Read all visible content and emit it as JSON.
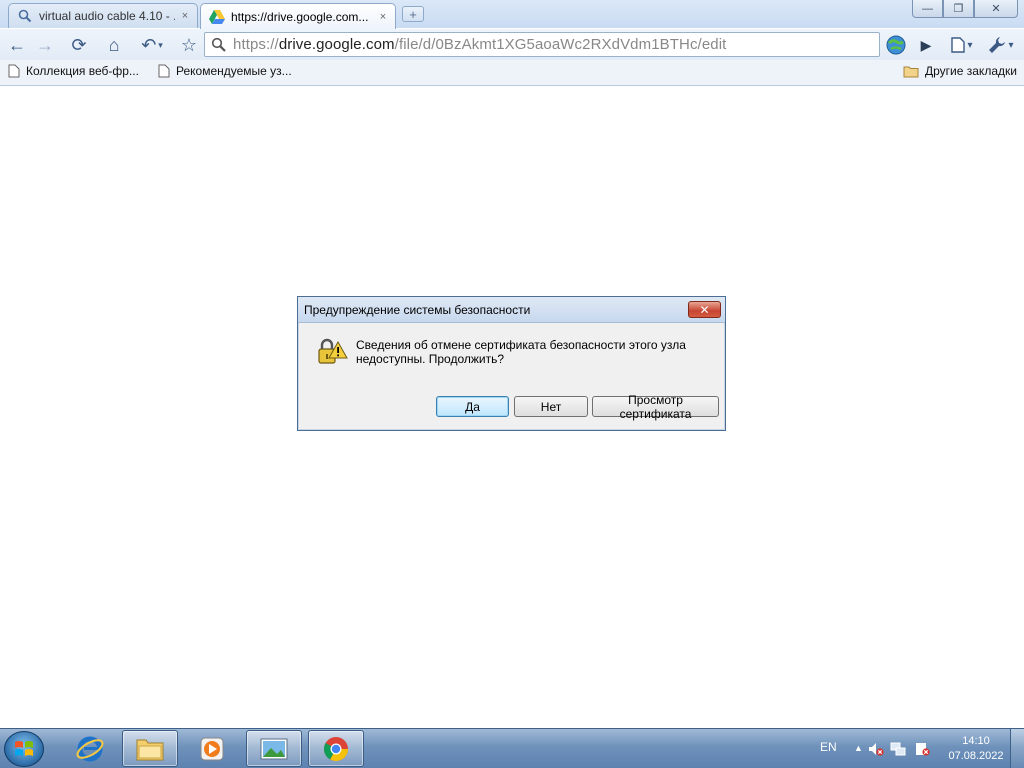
{
  "browser": {
    "tabs": [
      {
        "title": "virtual audio cable 4.10 - ...",
        "icon": "search-icon",
        "close": "×",
        "active": false
      },
      {
        "title": "https://drive.google.com...",
        "icon": "google-drive-icon",
        "close": "×",
        "active": true
      }
    ],
    "new_tab": "+",
    "window_controls": {
      "minimize": "—",
      "maximize": "❐",
      "close": "✕"
    },
    "toolbar": {
      "back": "←",
      "forward": "→",
      "reload": "⟳",
      "home": "⌂",
      "undo": "↶",
      "star": "☆",
      "play": "▶",
      "page_menu": "▾",
      "wrench": "▾"
    },
    "address": {
      "scheme": "https://",
      "host": "drive.google.com",
      "path": "/file/d/0BzAkmt1XG5aoaWc2RXdVdm1BTHc/edit"
    },
    "bookmarks": [
      {
        "label": "Коллекция веб-фр...",
        "icon": "page-icon"
      },
      {
        "label": "Рекомендуемые уз...",
        "icon": "page-icon"
      }
    ],
    "other_bookmarks": {
      "label": "Другие закладки",
      "icon": "folder-icon"
    }
  },
  "dialog": {
    "title": "Предупреждение системы безопасности",
    "close": "✕",
    "message_line1": "Сведения об отмене сертификата безопасности этого узла",
    "message_line2": "недоступны. Продолжить?",
    "buttons": {
      "yes": "Да",
      "no": "Нет",
      "view_cert": "Просмотр сертификата"
    }
  },
  "taskbar": {
    "items": [
      {
        "name": "internet-explorer-icon"
      },
      {
        "name": "windows-explorer-icon"
      },
      {
        "name": "media-player-icon"
      },
      {
        "name": "picture-viewer-icon"
      },
      {
        "name": "chrome-icon"
      }
    ],
    "language": "EN",
    "show_hidden": "▲",
    "time": "14:10",
    "date": "07.08.2022"
  },
  "colors": {
    "accent": "#3c5a84",
    "dialog_close": "#c74531",
    "taskbar": "#6f92bb"
  }
}
